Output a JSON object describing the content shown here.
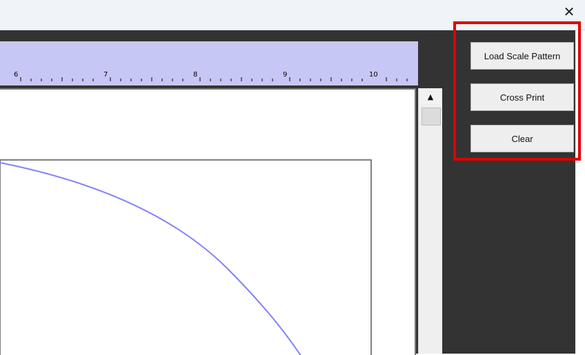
{
  "window": {
    "close_glyph": "✕"
  },
  "ruler": {
    "labels": [
      "6",
      "7",
      "8",
      "9",
      "10"
    ],
    "color": "#c7c7f5"
  },
  "scrollbar": {
    "up_arrow": "▲"
  },
  "buttons": {
    "load_scale_pattern": "Load Scale Pattern",
    "cross_print": "Cross Print",
    "clear": "Clear"
  },
  "colors": {
    "workspace": "#333333",
    "curve": "#8080ff",
    "highlight": "#e00000"
  }
}
